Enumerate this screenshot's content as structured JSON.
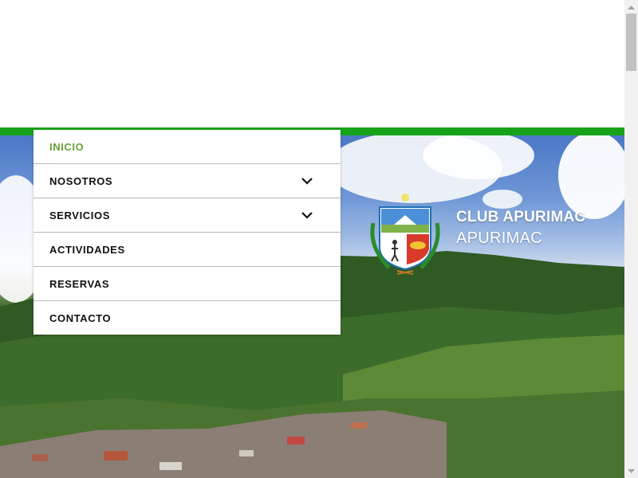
{
  "nav": {
    "items": [
      {
        "label": "INICIO",
        "active": true,
        "has_dropdown": false
      },
      {
        "label": "NOSOTROS",
        "active": false,
        "has_dropdown": true
      },
      {
        "label": "SERVICIOS",
        "active": false,
        "has_dropdown": true
      },
      {
        "label": "ACTIVIDADES",
        "active": false,
        "has_dropdown": false
      },
      {
        "label": "RESERVAS",
        "active": false,
        "has_dropdown": false
      },
      {
        "label": "CONTACTO",
        "active": false,
        "has_dropdown": false
      }
    ]
  },
  "brand": {
    "line1": "CLUB APURIMAC",
    "line2": "APURIMAC",
    "logo": "apurimac-coat-of-arms"
  },
  "colors": {
    "accent_green": "#16a31a",
    "active_item": "#6aa23a"
  }
}
